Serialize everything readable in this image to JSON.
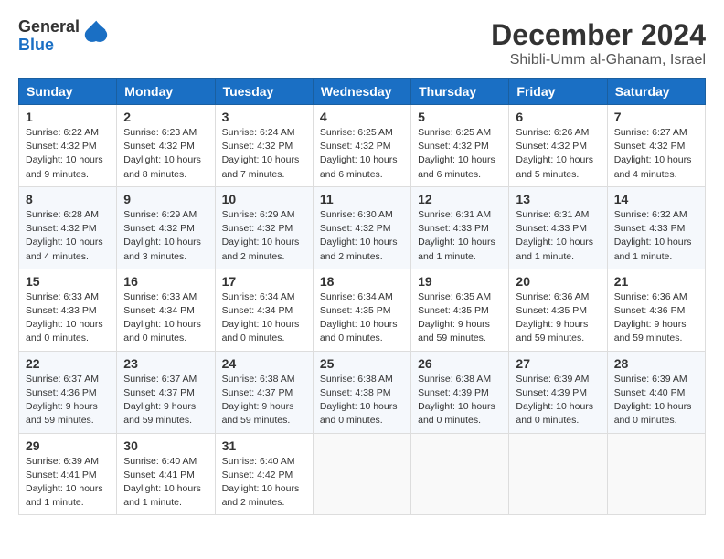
{
  "header": {
    "logo_general": "General",
    "logo_blue": "Blue",
    "main_title": "December 2024",
    "sub_title": "Shibli-Umm al-Ghanam, Israel"
  },
  "weekdays": [
    "Sunday",
    "Monday",
    "Tuesday",
    "Wednesday",
    "Thursday",
    "Friday",
    "Saturday"
  ],
  "weeks": [
    [
      {
        "day": "1",
        "sunrise": "6:22 AM",
        "sunset": "4:32 PM",
        "daylight": "10 hours and 9 minutes."
      },
      {
        "day": "2",
        "sunrise": "6:23 AM",
        "sunset": "4:32 PM",
        "daylight": "10 hours and 8 minutes."
      },
      {
        "day": "3",
        "sunrise": "6:24 AM",
        "sunset": "4:32 PM",
        "daylight": "10 hours and 7 minutes."
      },
      {
        "day": "4",
        "sunrise": "6:25 AM",
        "sunset": "4:32 PM",
        "daylight": "10 hours and 6 minutes."
      },
      {
        "day": "5",
        "sunrise": "6:25 AM",
        "sunset": "4:32 PM",
        "daylight": "10 hours and 6 minutes."
      },
      {
        "day": "6",
        "sunrise": "6:26 AM",
        "sunset": "4:32 PM",
        "daylight": "10 hours and 5 minutes."
      },
      {
        "day": "7",
        "sunrise": "6:27 AM",
        "sunset": "4:32 PM",
        "daylight": "10 hours and 4 minutes."
      }
    ],
    [
      {
        "day": "8",
        "sunrise": "6:28 AM",
        "sunset": "4:32 PM",
        "daylight": "10 hours and 4 minutes."
      },
      {
        "day": "9",
        "sunrise": "6:29 AM",
        "sunset": "4:32 PM",
        "daylight": "10 hours and 3 minutes."
      },
      {
        "day": "10",
        "sunrise": "6:29 AM",
        "sunset": "4:32 PM",
        "daylight": "10 hours and 2 minutes."
      },
      {
        "day": "11",
        "sunrise": "6:30 AM",
        "sunset": "4:32 PM",
        "daylight": "10 hours and 2 minutes."
      },
      {
        "day": "12",
        "sunrise": "6:31 AM",
        "sunset": "4:33 PM",
        "daylight": "10 hours and 1 minute."
      },
      {
        "day": "13",
        "sunrise": "6:31 AM",
        "sunset": "4:33 PM",
        "daylight": "10 hours and 1 minute."
      },
      {
        "day": "14",
        "sunrise": "6:32 AM",
        "sunset": "4:33 PM",
        "daylight": "10 hours and 1 minute."
      }
    ],
    [
      {
        "day": "15",
        "sunrise": "6:33 AM",
        "sunset": "4:33 PM",
        "daylight": "10 hours and 0 minutes."
      },
      {
        "day": "16",
        "sunrise": "6:33 AM",
        "sunset": "4:34 PM",
        "daylight": "10 hours and 0 minutes."
      },
      {
        "day": "17",
        "sunrise": "6:34 AM",
        "sunset": "4:34 PM",
        "daylight": "10 hours and 0 minutes."
      },
      {
        "day": "18",
        "sunrise": "6:34 AM",
        "sunset": "4:35 PM",
        "daylight": "10 hours and 0 minutes."
      },
      {
        "day": "19",
        "sunrise": "6:35 AM",
        "sunset": "4:35 PM",
        "daylight": "9 hours and 59 minutes."
      },
      {
        "day": "20",
        "sunrise": "6:36 AM",
        "sunset": "4:35 PM",
        "daylight": "9 hours and 59 minutes."
      },
      {
        "day": "21",
        "sunrise": "6:36 AM",
        "sunset": "4:36 PM",
        "daylight": "9 hours and 59 minutes."
      }
    ],
    [
      {
        "day": "22",
        "sunrise": "6:37 AM",
        "sunset": "4:36 PM",
        "daylight": "9 hours and 59 minutes."
      },
      {
        "day": "23",
        "sunrise": "6:37 AM",
        "sunset": "4:37 PM",
        "daylight": "9 hours and 59 minutes."
      },
      {
        "day": "24",
        "sunrise": "6:38 AM",
        "sunset": "4:37 PM",
        "daylight": "9 hours and 59 minutes."
      },
      {
        "day": "25",
        "sunrise": "6:38 AM",
        "sunset": "4:38 PM",
        "daylight": "10 hours and 0 minutes."
      },
      {
        "day": "26",
        "sunrise": "6:38 AM",
        "sunset": "4:39 PM",
        "daylight": "10 hours and 0 minutes."
      },
      {
        "day": "27",
        "sunrise": "6:39 AM",
        "sunset": "4:39 PM",
        "daylight": "10 hours and 0 minutes."
      },
      {
        "day": "28",
        "sunrise": "6:39 AM",
        "sunset": "4:40 PM",
        "daylight": "10 hours and 0 minutes."
      }
    ],
    [
      {
        "day": "29",
        "sunrise": "6:39 AM",
        "sunset": "4:41 PM",
        "daylight": "10 hours and 1 minute."
      },
      {
        "day": "30",
        "sunrise": "6:40 AM",
        "sunset": "4:41 PM",
        "daylight": "10 hours and 1 minute."
      },
      {
        "day": "31",
        "sunrise": "6:40 AM",
        "sunset": "4:42 PM",
        "daylight": "10 hours and 2 minutes."
      },
      null,
      null,
      null,
      null
    ]
  ]
}
